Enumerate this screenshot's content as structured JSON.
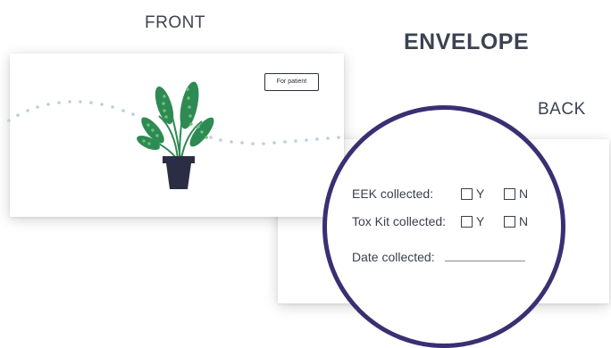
{
  "labels": {
    "front": "FRONT",
    "envelope": "ENVELOPE",
    "back": "BACK"
  },
  "front_card": {
    "tag_text": "For patient"
  },
  "back_card": {
    "rows": [
      {
        "label": "EEK collected:",
        "yes": "Y",
        "no": "N"
      },
      {
        "label": "Tox Kit collected:",
        "yes": "Y",
        "no": "N"
      }
    ],
    "date_label": "Date collected:"
  },
  "colors": {
    "zoom_border": "#3b2f73",
    "dots": "#b9cfdc",
    "leaf": "#2e8a53",
    "leaf_light": "#6fc07a",
    "pot": "#2b2d45"
  },
  "icons": {
    "plant": "potted-plant-icon"
  }
}
